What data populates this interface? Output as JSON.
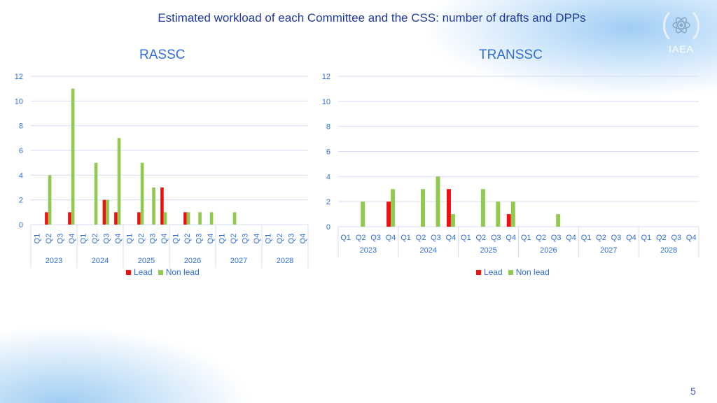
{
  "slide": {
    "title": "Estimated workload of each Committee and the CSS: number of drafts and DPPs",
    "page_number": "5",
    "logo_text": "IAEA",
    "logo_icon": "iaea-emblem-icon"
  },
  "colors": {
    "lead": "#ee1111",
    "non_lead": "#92c950",
    "text": "#2f6fd6",
    "grid": "#d6dcf2"
  },
  "chart_data": [
    {
      "type": "bar",
      "title": "RASSC",
      "xlabel": "",
      "ylabel": "",
      "ylim": [
        0,
        12
      ],
      "yticks": [
        0,
        2,
        4,
        6,
        8,
        10,
        12
      ],
      "grid": true,
      "legend": "bottom",
      "years": [
        "2023",
        "2024",
        "2025",
        "2026",
        "2027",
        "2028"
      ],
      "quarters": [
        "Q1",
        "Q2",
        "Q3",
        "Q4"
      ],
      "quarter_label_rotation": "vertical",
      "series": [
        {
          "name": "Lead",
          "values": [
            0,
            1,
            0,
            1,
            0,
            0,
            2,
            1,
            0,
            1,
            0,
            3,
            0,
            1,
            0,
            0,
            0,
            0,
            0,
            0,
            0,
            0,
            0,
            0
          ]
        },
        {
          "name": "Non lead",
          "values": [
            0,
            4,
            0,
            11,
            0,
            5,
            2,
            7,
            0,
            5,
            3,
            1,
            0,
            1,
            1,
            1,
            0,
            1,
            0,
            0,
            0,
            0,
            0,
            0
          ]
        }
      ]
    },
    {
      "type": "bar",
      "title": "TRANSSC",
      "xlabel": "",
      "ylabel": "",
      "ylim": [
        0,
        12
      ],
      "yticks": [
        0,
        2,
        4,
        6,
        8,
        10,
        12
      ],
      "grid": true,
      "legend": "bottom",
      "years": [
        "2023",
        "2024",
        "2025",
        "2026",
        "2027",
        "2028"
      ],
      "quarters": [
        "Q1",
        "Q2",
        "Q3",
        "Q4"
      ],
      "quarter_label_rotation": "horizontal",
      "series": [
        {
          "name": "Lead",
          "values": [
            0,
            0,
            0,
            2,
            0,
            0,
            0,
            3,
            0,
            0,
            0,
            1,
            0,
            0,
            0,
            0,
            0,
            0,
            0,
            0,
            0,
            0,
            0,
            0
          ]
        },
        {
          "name": "Non lead",
          "values": [
            0,
            2,
            0,
            3,
            0,
            3,
            4,
            1,
            0,
            3,
            2,
            2,
            0,
            0,
            1,
            0,
            0,
            0,
            0,
            0,
            0,
            0,
            0,
            0
          ]
        }
      ]
    }
  ]
}
